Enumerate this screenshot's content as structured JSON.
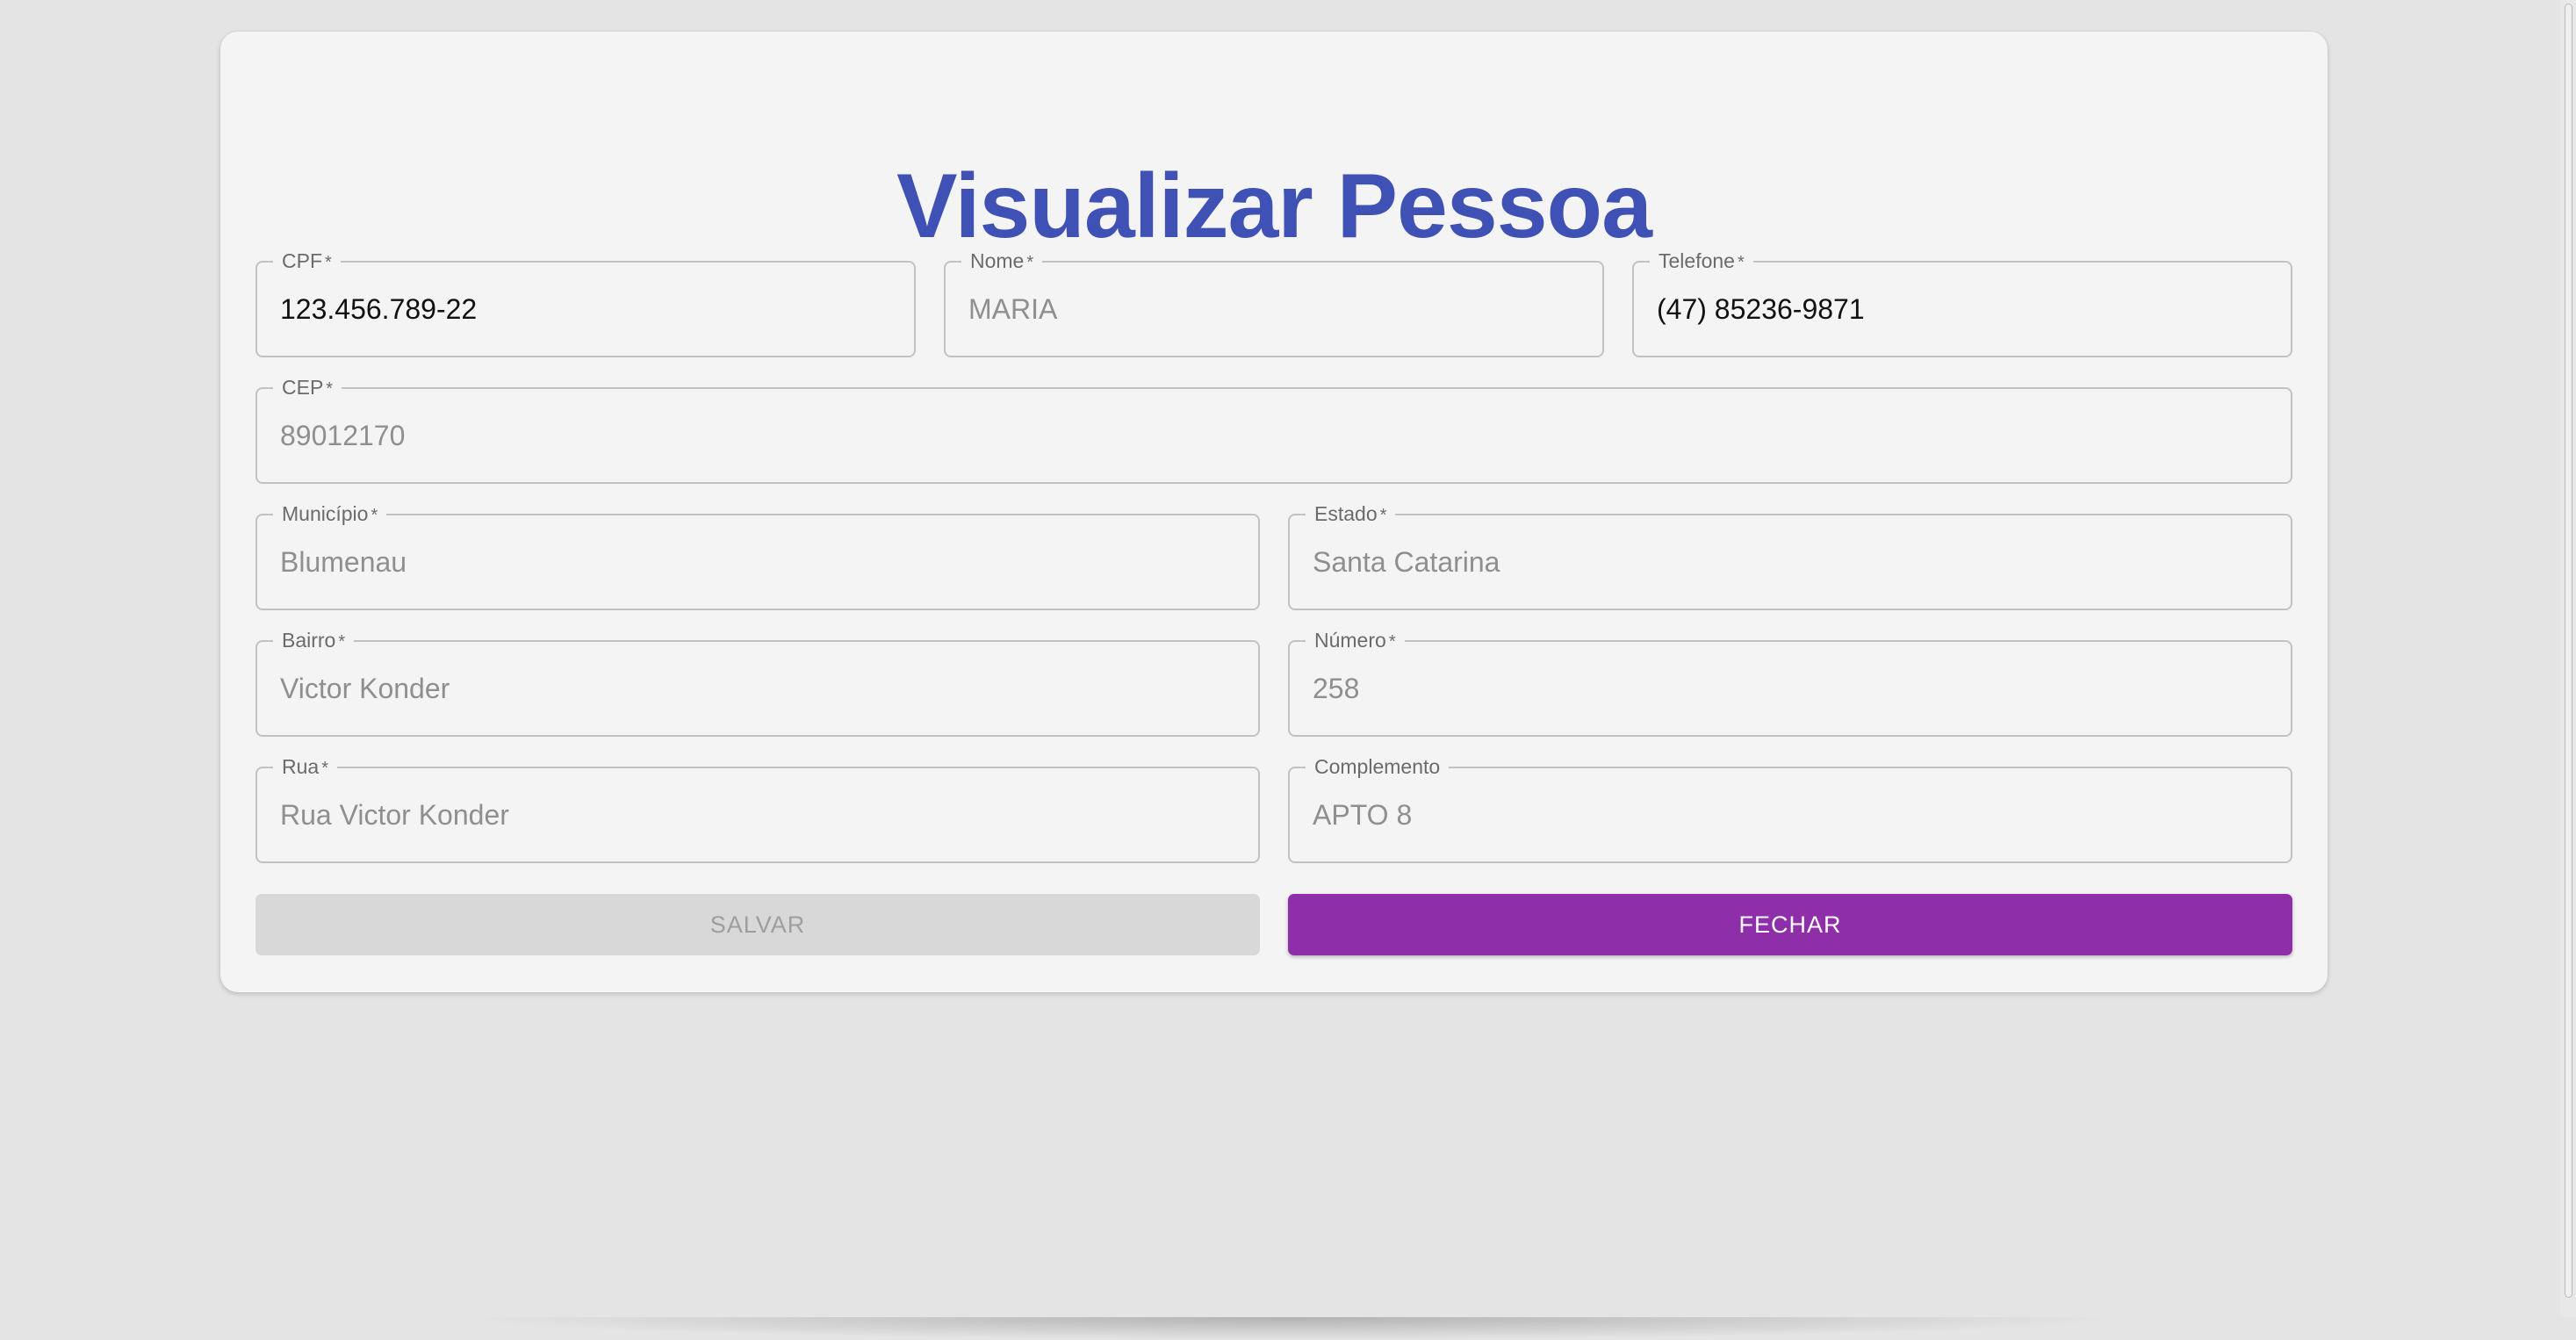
{
  "page": {
    "title": "Visualizar Pessoa"
  },
  "required_marker": "*",
  "fields": {
    "cpf": {
      "label": "CPF",
      "value": "123.456.789-22",
      "required": true,
      "enabled": true
    },
    "nome": {
      "label": "Nome",
      "value": "MARIA",
      "required": true,
      "enabled": false
    },
    "telefone": {
      "label": "Telefone",
      "value": "(47) 85236-9871",
      "required": true,
      "enabled": true
    },
    "cep": {
      "label": "CEP",
      "value": "89012170",
      "required": true,
      "enabled": false
    },
    "municipio": {
      "label": "Município",
      "value": "Blumenau",
      "required": true,
      "enabled": false
    },
    "estado": {
      "label": "Estado",
      "value": "Santa Catarina",
      "required": true,
      "enabled": false
    },
    "bairro": {
      "label": "Bairro",
      "value": "Victor Konder",
      "required": true,
      "enabled": false
    },
    "numero": {
      "label": "Número",
      "value": "258",
      "required": true,
      "enabled": false
    },
    "rua": {
      "label": "Rua",
      "value": "Rua Victor Konder",
      "required": true,
      "enabled": false
    },
    "complemento": {
      "label": "Complemento",
      "value": "APTO 8",
      "required": false,
      "enabled": false
    }
  },
  "buttons": {
    "salvar": {
      "label": "SALVAR",
      "enabled": false
    },
    "fechar": {
      "label": "FECHAR",
      "enabled": true
    }
  },
  "colors": {
    "title": "#3f51b5",
    "primary_button": "#8e2ea8",
    "disabled_button": "#d8d8d8",
    "background": "#e4e4e4",
    "card": "#f4f4f4"
  }
}
